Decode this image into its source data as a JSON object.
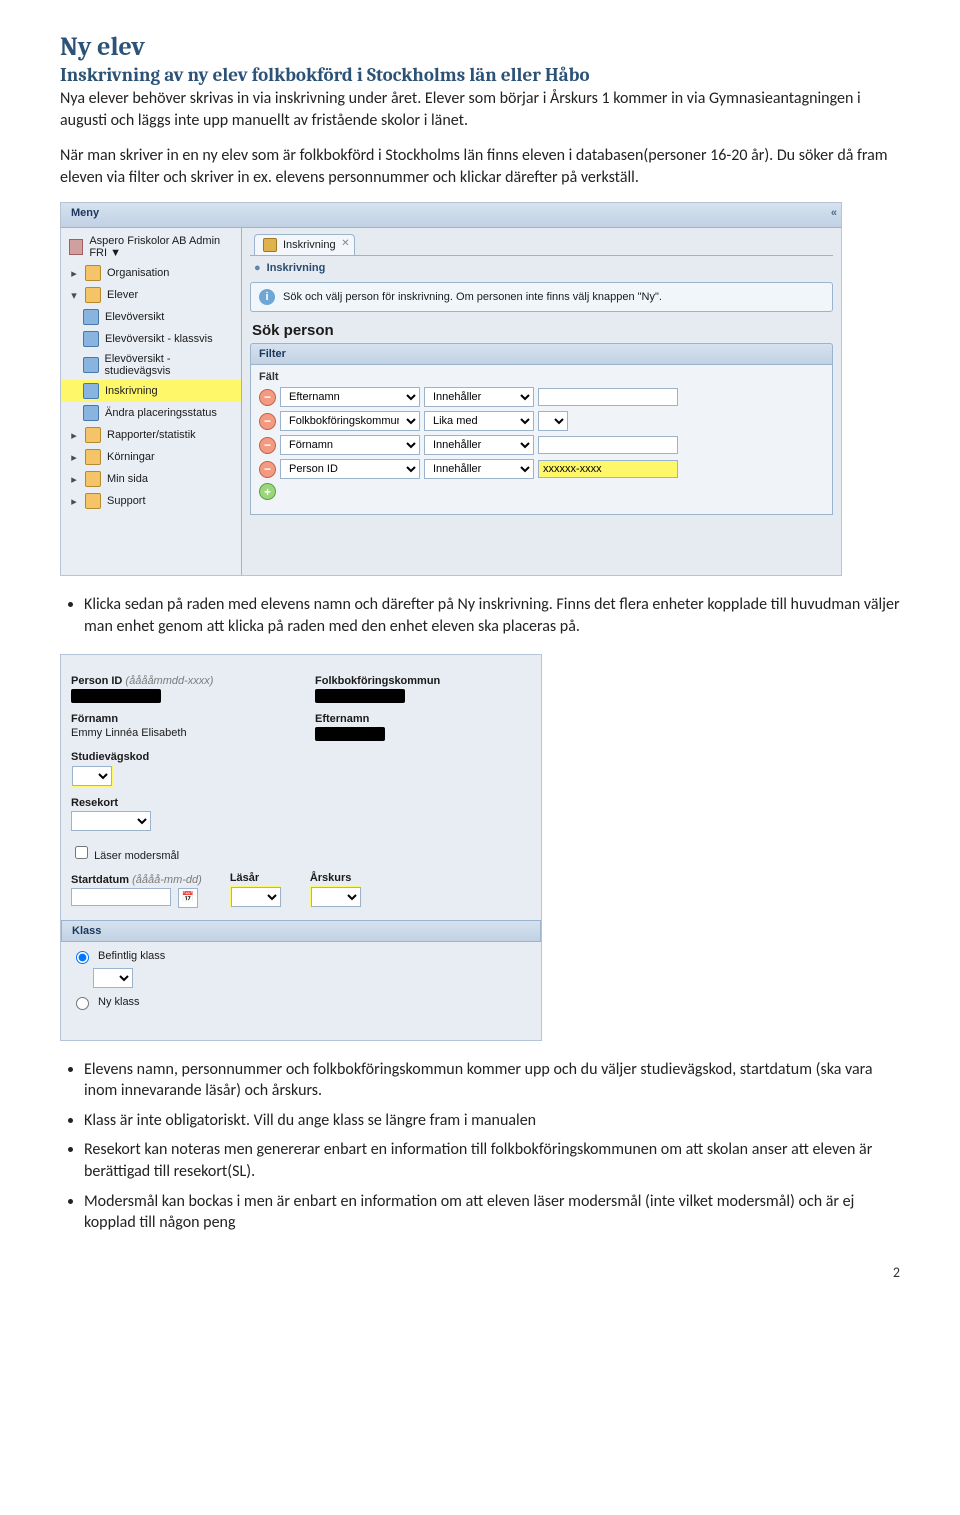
{
  "doc": {
    "title": "Ny elev",
    "subtitle": "Inskrivning av ny elev folkbokförd i Stockholms län eller Håbo",
    "para1": "Nya elever behöver skrivas in via inskrivning under året. Elever som börjar i Årskurs 1 kommer in via Gymnasieantagningen i augusti och läggs inte upp manuellt av fristående skolor i länet.",
    "para2": "När man skriver in en ny elev som är folkbokförd i Stockholms län finns eleven i databasen(personer 16-20 år). Du söker då fram eleven via filter och skriver in ex. elevens personnummer och klickar därefter på verkställ.",
    "bullet_mid": "Klicka sedan på raden med elevens namn och därefter på Ny inskrivning. Finns det flera enheter kopplade till huvudman väljer man enhet genom att klicka på raden med den enhet eleven ska placeras på.",
    "mid_italic": "Ny inskrivning",
    "bullets_bottom": [
      "Elevens namn, personnummer och folkbokföringskommun kommer upp och du väljer studievägskod, startdatum (ska vara inom innevarande läsår) och årskurs.",
      "Klass är inte obligatoriskt. Vill du ange klass se längre fram i manualen",
      "Resekort kan noteras men genererar enbart en information till folkbokföringskommunen om att skolan anser att eleven är berättigad till resekort(SL).",
      "Modersmål kan bockas i men är enbart en information om att eleven läser modersmål (inte vilket modersmål) och är ej kopplad till någon peng"
    ],
    "page_number": "2"
  },
  "app": {
    "menu_label": "Meny",
    "org_root": "Aspero Friskolor AB Admin FRI ▼",
    "tree": {
      "organisation": "Organisation",
      "elever": "Elever",
      "elevoversikt": "Elevöversikt",
      "elevoversikt_klass": "Elevöversikt - klassvis",
      "elevoversikt_stud": "Elevöversikt - studievägsvis",
      "inskrivning": "Inskrivning",
      "andra_placer": "Ändra placeringsstatus",
      "rapporter": "Rapporter/statistik",
      "korningar": "Körningar",
      "min_sida": "Min sida",
      "support": "Support"
    },
    "tab": {
      "label": "Inskrivning"
    },
    "crumb": "Inskrivning",
    "info_text": "Sök och välj person för inskrivning. Om personen inte finns välj knappen \"Ny\".",
    "sok_person": "Sök person",
    "filter_label": "Filter",
    "filter_head": "Fält",
    "filters": [
      {
        "field": "Efternamn",
        "op": "Innehåller",
        "val": ""
      },
      {
        "field": "Folkbokföringskommun",
        "op": "Lika med",
        "val": ""
      },
      {
        "field": "Förnamn",
        "op": "Innehåller",
        "val": ""
      },
      {
        "field": "Person ID",
        "op": "Innehåller",
        "val": "xxxxxx-xxxx"
      }
    ]
  },
  "form": {
    "person_id_label": "Person ID",
    "person_id_hint": "(ååååmmdd-xxxx)",
    "folkkommun_label": "Folkbokföringskommun",
    "fornamn_label": "Förnamn",
    "fornamn_val": "Emmy Linnéa Elisabeth",
    "efternamn_label": "Efternamn",
    "studievagskod_label": "Studievägskod",
    "resekort_label": "Resekort",
    "laser_modersmal_label": "Läser modersmål",
    "startdatum_label": "Startdatum",
    "startdatum_hint": "(åååå-mm-dd)",
    "lasar_label": "Läsår",
    "arskurs_label": "Årskurs",
    "klass_label": "Klass",
    "befintlig_klass": "Befintlig klass",
    "ny_klass": "Ny klass"
  }
}
